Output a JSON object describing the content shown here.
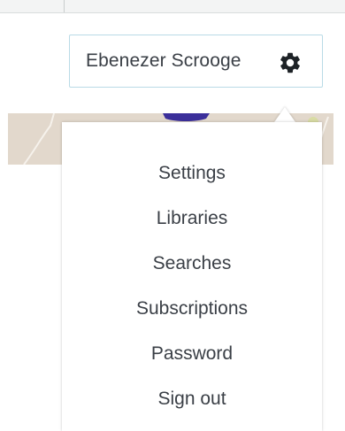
{
  "user_menu": {
    "user_name": "Ebenezer Scrooge",
    "icon": "gear-icon"
  },
  "dropdown": {
    "items": [
      {
        "label": "Settings"
      },
      {
        "label": "Libraries"
      },
      {
        "label": "Searches"
      },
      {
        "label": "Subscriptions"
      },
      {
        "label": "Password"
      },
      {
        "label": "Sign out"
      }
    ]
  },
  "colors": {
    "toggle_border": "#b9dbe6",
    "text": "#3a3f46",
    "map_land": "#e2d8cc",
    "map_marker": "#3b2f9a"
  }
}
